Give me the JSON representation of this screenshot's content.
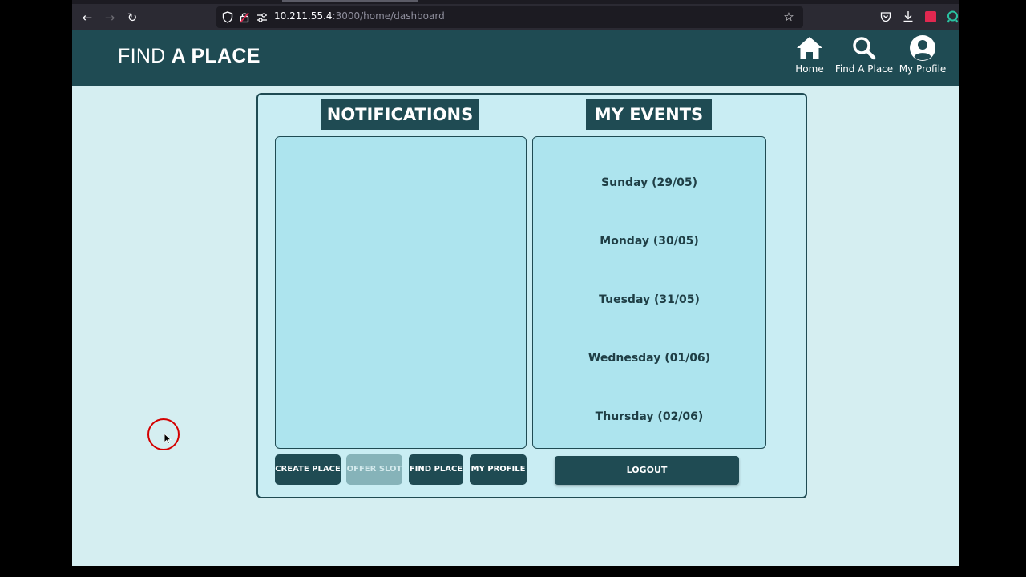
{
  "browser": {
    "url_host": "10.211.55.4",
    "url_path": ":3000/home/dashboard"
  },
  "header": {
    "brand_light": "FIND ",
    "brand_bold": "A PLACE",
    "nav": [
      {
        "label": "Home",
        "icon": "home-icon"
      },
      {
        "label": "Find A Place",
        "icon": "search-icon"
      },
      {
        "label": "My Profile",
        "icon": "user-circle-icon"
      }
    ]
  },
  "dashboard": {
    "notifications_title": "NOTIFICATIONS",
    "events_title": "MY EVENTS",
    "events": [
      "Sunday (29/05)",
      "Monday (30/05)",
      "Tuesday (31/05)",
      "Wednesday (01/06)",
      "Thursday (02/06)"
    ],
    "buttons": {
      "create_place": "CREATE PLACE",
      "offer_slot": "OFFER SLOT",
      "find_place": "FIND PLACE",
      "my_profile": "MY PROFILE",
      "logout": "LOGOUT"
    }
  },
  "colors": {
    "header_bg": "#1f4b53",
    "page_bg": "#d5eef1",
    "panel_bg": "#ade4ee",
    "disabled_button": "#86b3b9"
  }
}
